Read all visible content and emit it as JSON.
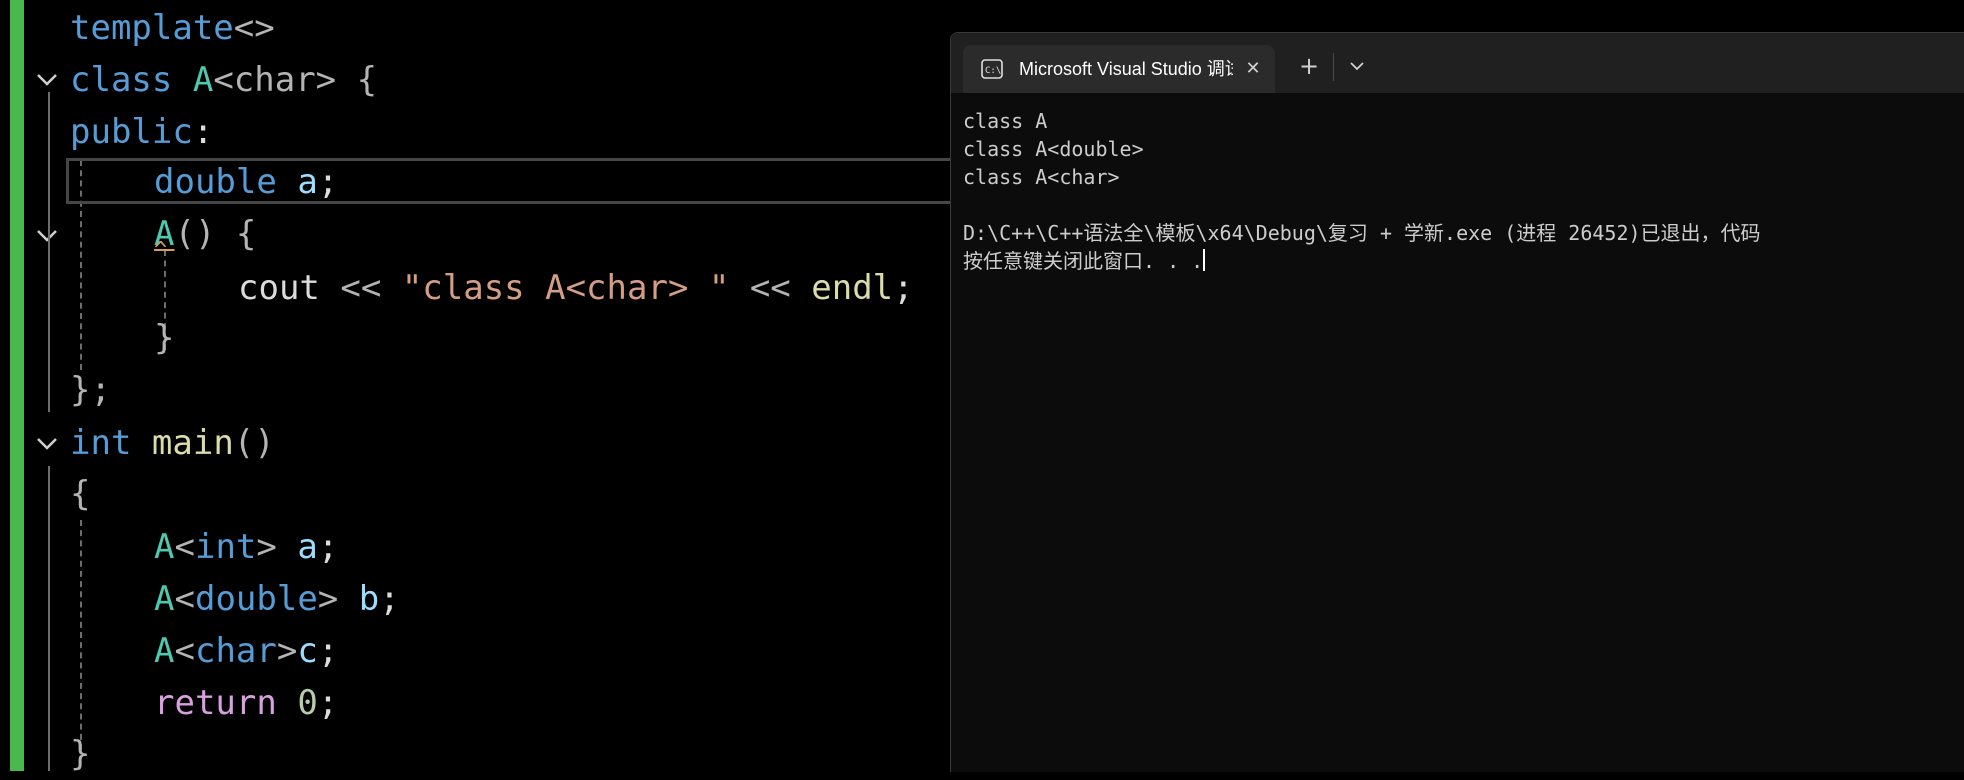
{
  "editor": {
    "line_template": {
      "keyword": "template",
      "args": "<>"
    },
    "line_class": {
      "keyword": "class",
      "name": "A",
      "args": "<char>",
      "brace": "{"
    },
    "line_public": {
      "keyword": "public",
      "colon": ":"
    },
    "line_member": {
      "type": "double",
      "name": "a",
      "semi": ";"
    },
    "line_ctor": {
      "name": "A",
      "parens": "()",
      "brace": "{"
    },
    "line_cout": {
      "ident": "cout",
      "op1": "<<",
      "string": "\"class A<char> \"",
      "op2": "<<",
      "endl": "endl",
      "semi": ";"
    },
    "line_ctor_close": {
      "brace": "}"
    },
    "line_class_close": {
      "brace": "};"
    },
    "line_main": {
      "keyword": "int",
      "name": "main",
      "parens": "()"
    },
    "line_main_open": {
      "brace": "{"
    },
    "line_decl1": {
      "type": "A",
      "args_open": "<",
      "args_type": "int",
      "args_close": ">",
      "var": "a",
      "semi": ";"
    },
    "line_decl2": {
      "type": "A",
      "args_open": "<",
      "args_type": "double",
      "args_close": ">",
      "var": "b",
      "semi": ";"
    },
    "line_decl3": {
      "type": "A",
      "args_open": "<",
      "args_type": "char",
      "args_close": ">",
      "var": "c",
      "semi": ";"
    },
    "line_return": {
      "keyword": "return",
      "value": "0",
      "semi": ";"
    },
    "line_main_close": {
      "brace": "}"
    },
    "caret_mark": "^",
    "gutter_color": "#4bb84e"
  },
  "terminal": {
    "tab_title": "Microsoft Visual Studio 调试控",
    "tab_icon": "console-icon",
    "close_glyph": "✕",
    "new_tab_glyph": "+",
    "dropdown_icon": "chevron-down-icon",
    "lines": [
      "class A",
      "class A<double>",
      "class A<char>",
      "",
      "D:\\C++\\C++语法全\\模板\\x64\\Debug\\复习 + 学新.exe (进程 26452)已退出，代码",
      "按任意键关闭此窗口. . ."
    ]
  }
}
